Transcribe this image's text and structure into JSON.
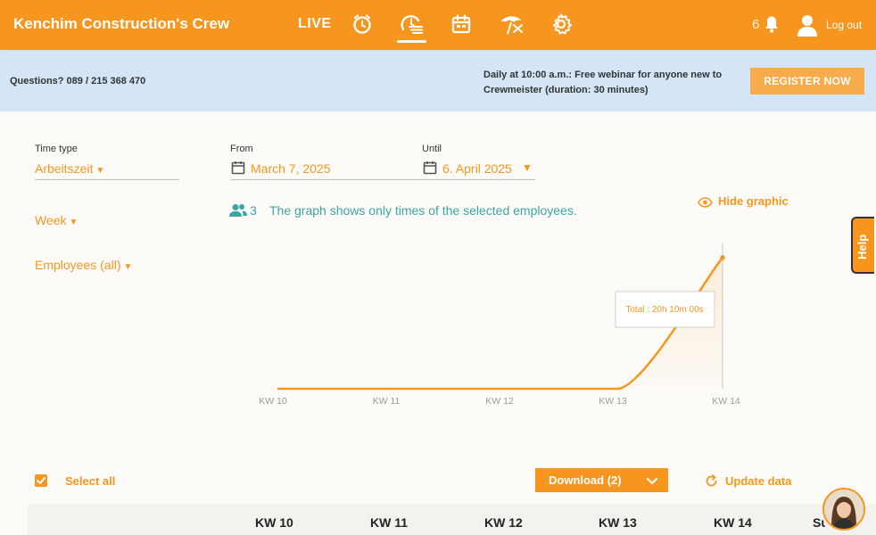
{
  "header": {
    "title": "Kenchim Construction's Crew",
    "live_label": "LIVE",
    "notification_count": "6",
    "logout_label": "Log out",
    "nav_icons": [
      "clock-icon",
      "time-report-icon",
      "calendar-icon",
      "vacation-icon",
      "gear-icon"
    ],
    "active_nav": "time-report-icon"
  },
  "banner": {
    "questions": "Questions? 089 / 215 368 470",
    "webinar_line1": "Daily at 10:00 a.m.: Free webinar for anyone new to",
    "webinar_line2": "Crewmeister (duration: 30 minutes)",
    "register_label": "REGISTER NOW"
  },
  "filters": {
    "time_type_label": "Time type",
    "time_type_value": "Arbeitszeit",
    "from_label": "From",
    "from_value": "March 7, 2025",
    "until_label": "Until",
    "until_value": "6. April 2025",
    "grouping_value": "Week",
    "employees_value": "Employees (all)"
  },
  "graph_info": {
    "employee_count": "3",
    "note": "The graph shows only times of the selected employees.",
    "hide_label": "Hide graphic"
  },
  "help_label": "Help",
  "chart_data": {
    "type": "line",
    "categories": [
      "KW 10",
      "KW 11",
      "KW 12",
      "KW 13",
      "KW 14"
    ],
    "series": [
      {
        "values": [
          0,
          0,
          0,
          0,
          20.17
        ]
      }
    ],
    "tooltip": "Total : 20h 10m 00s",
    "tooltip_category": "KW 14",
    "grid": false
  },
  "actions": {
    "select_all_label": "Select all",
    "download_label": "Download (2)",
    "update_label": "Update data"
  },
  "table": {
    "columns": [
      "KW 10",
      "KW 11",
      "KW 12",
      "KW 13",
      "KW 14",
      "Su"
    ]
  },
  "colors": {
    "accent": "#f7961f",
    "banner": "#d4e5f6",
    "teal": "#3aa5a6"
  }
}
